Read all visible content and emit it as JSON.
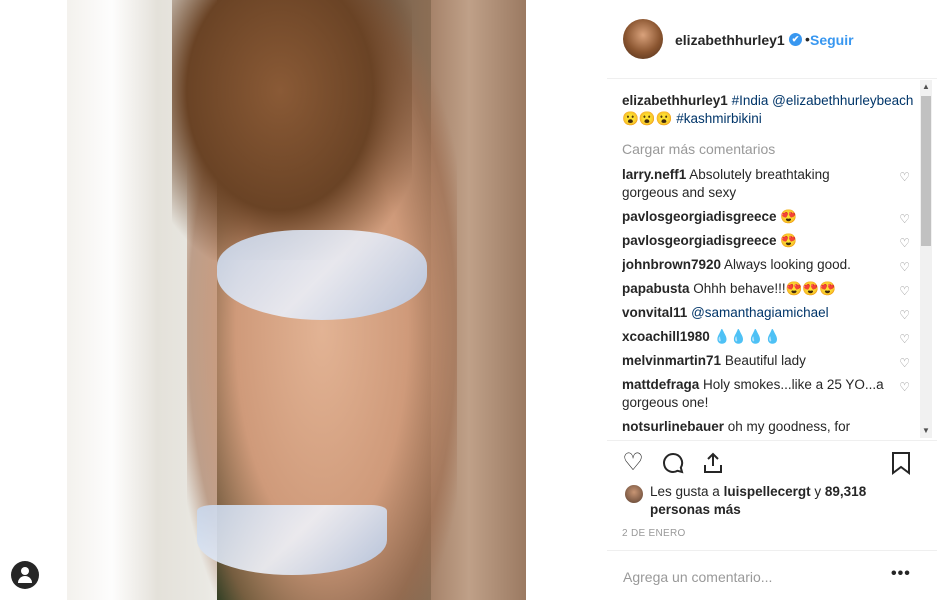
{
  "header": {
    "username": "elizabethhurley1",
    "verified_glyph": "✔",
    "separator": "•",
    "follow_label": "Seguir"
  },
  "caption": {
    "username": "elizabethhurley1",
    "tag1": "#India",
    "mention": "@elizabethhurleybeach",
    "emoji": "😮😮😮",
    "tag2": "#kashmirbikini"
  },
  "load_more": "Cargar más comentarios",
  "comments": [
    {
      "user": "larry.neff1",
      "text": "Absolutely breathtaking gorgeous and sexy"
    },
    {
      "user": "pavlosgeorgiadisgreece",
      "text": "😍"
    },
    {
      "user": "pavlosgeorgiadisgreece",
      "text": "😍"
    },
    {
      "user": "johnbrown7920",
      "text": "Always looking good."
    },
    {
      "user": "papabusta",
      "text": "Ohhh behave!!!😍😍😍"
    },
    {
      "user": "vonvital11",
      "text": "@samanthagiamichael"
    },
    {
      "user": "xcoachill1980",
      "text": "💧💧💧💧"
    },
    {
      "user": "melvinmartin71",
      "text": "Beautiful lady"
    },
    {
      "user": "mattdefraga",
      "text": "Holy smokes...like a 25 YO...a gorgeous one!"
    },
    {
      "user": "notsurlinebauer",
      "text": "oh my goodness, for"
    }
  ],
  "icons": {
    "like": "heart-icon",
    "comment": "comment-icon",
    "share": "share-icon",
    "save": "bookmark-icon"
  },
  "likes": {
    "prefix": "Les gusta a",
    "user": "luispellecergt",
    "conj": "y",
    "count": "89,318",
    "suffix": "personas más"
  },
  "date": "2 DE ENERO",
  "add_comment": {
    "placeholder": "Agrega un comentario...",
    "more": "•••"
  },
  "scroll": {
    "up": "▲",
    "down": "▼"
  }
}
